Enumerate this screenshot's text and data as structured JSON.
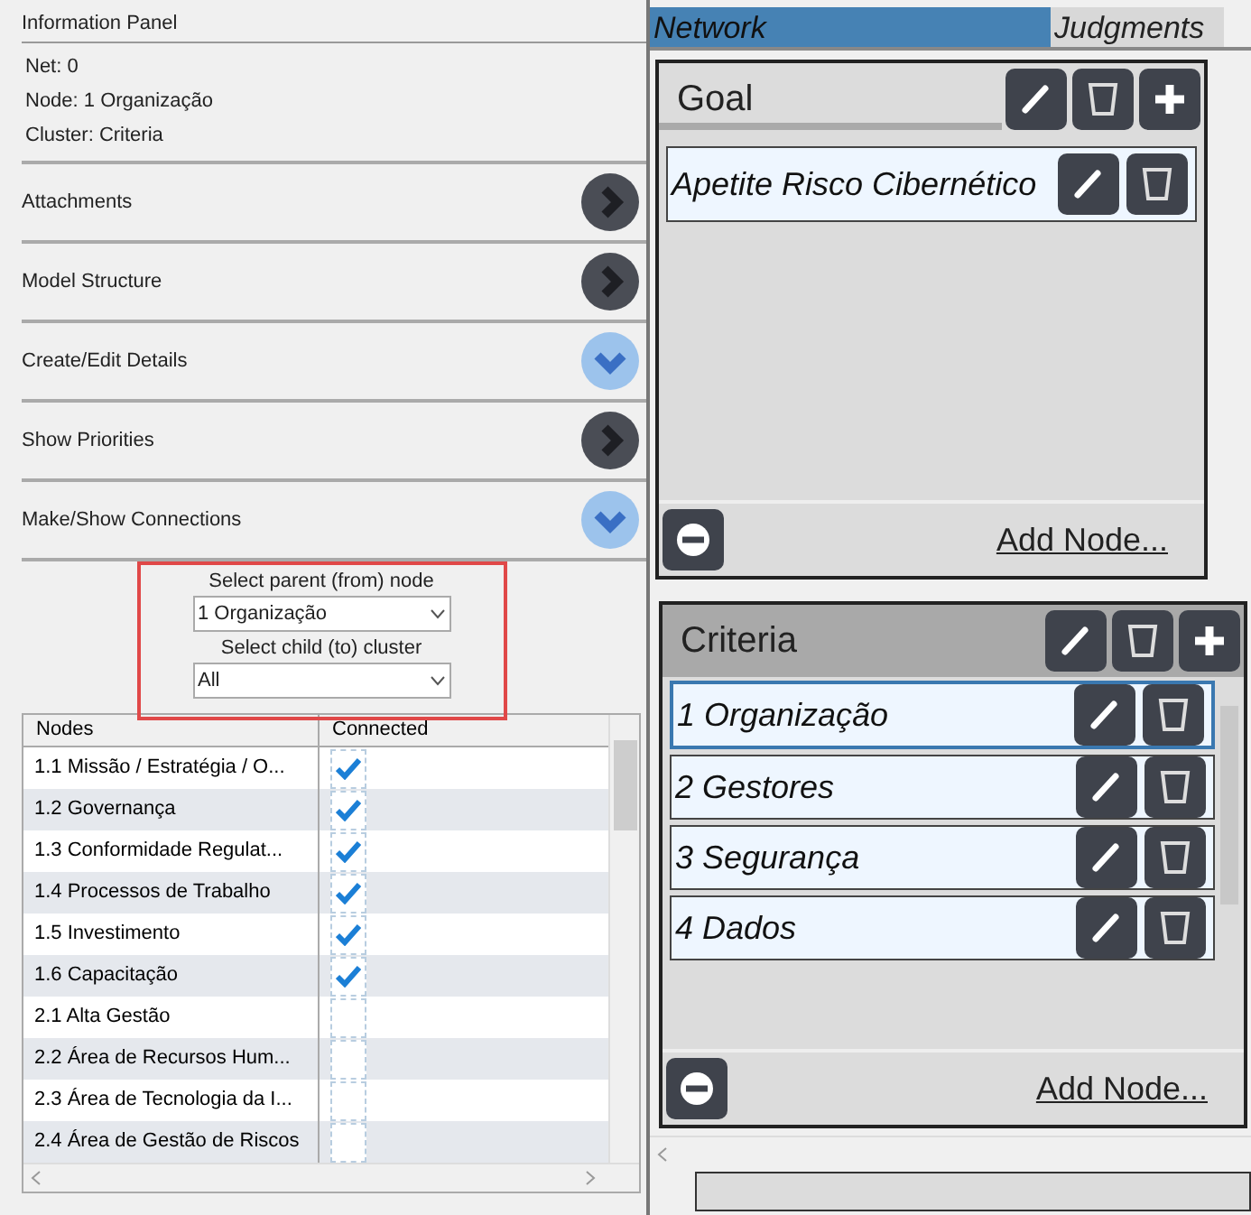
{
  "info_panel": {
    "title": "Information Panel",
    "lines": [
      "Net: 0",
      "Node: 1 Organização",
      "Cluster: Criteria"
    ]
  },
  "sections": [
    {
      "label": "Attachments",
      "expanded": false
    },
    {
      "label": "Model Structure",
      "expanded": false
    },
    {
      "label": "Create/Edit Details",
      "expanded": true
    },
    {
      "label": "Show Priorities",
      "expanded": false
    },
    {
      "label": "Make/Show Connections",
      "expanded": true
    }
  ],
  "connections": {
    "parent_label": "Select parent (from) node",
    "parent_value": "1 Organização",
    "child_label": "Select child (to) cluster",
    "child_value": "All"
  },
  "table": {
    "columns": [
      "Nodes",
      "Connected"
    ],
    "rows": [
      {
        "node": "1.1 Missão / Estratégia / O...",
        "checked": true
      },
      {
        "node": "1.2 Governança",
        "checked": true
      },
      {
        "node": "1.3 Conformidade Regulat...",
        "checked": true
      },
      {
        "node": "1.4 Processos de Trabalho",
        "checked": true
      },
      {
        "node": "1.5 Investimento",
        "checked": true
      },
      {
        "node": "1.6 Capacitação",
        "checked": true
      },
      {
        "node": "2.1 Alta Gestão",
        "checked": false
      },
      {
        "node": "2.2 Área de Recursos Hum...",
        "checked": false
      },
      {
        "node": "2.3 Área de Tecnologia da I...",
        "checked": false
      },
      {
        "node": "2.4 Área de Gestão de Riscos",
        "checked": false
      }
    ]
  },
  "tabs": [
    {
      "label": "Network",
      "selected": true
    },
    {
      "label": "Judgments",
      "selected": false
    }
  ],
  "clusters": [
    {
      "name": "Goal",
      "add_link": "Add Node...",
      "nodes": [
        {
          "name": "Apetite Risco Cibernético",
          "selected": false
        }
      ]
    },
    {
      "name": "Criteria",
      "add_link": "Add Node...",
      "nodes": [
        {
          "name": "1 Organização",
          "selected": true
        },
        {
          "name": "2 Gestores",
          "selected": false
        },
        {
          "name": "3 Segurança",
          "selected": false
        },
        {
          "name": "4 Dados",
          "selected": false
        }
      ]
    }
  ]
}
